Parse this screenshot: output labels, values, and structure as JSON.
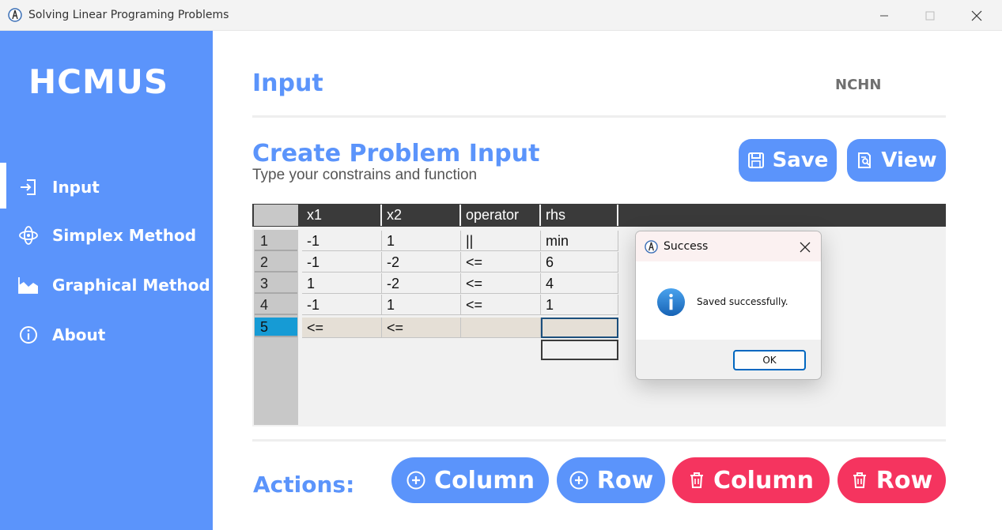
{
  "window": {
    "title": "Solving Linear Programing Problems",
    "minimize": "—",
    "maximize": "☐",
    "close": "✕"
  },
  "sidebar": {
    "brand": "HCMUS",
    "items": [
      {
        "label": "Input",
        "icon": "sign-in-icon",
        "active": true
      },
      {
        "label": "Simplex Method",
        "icon": "atom-icon"
      },
      {
        "label": "Graphical Method",
        "icon": "area-chart-icon"
      },
      {
        "label": "About",
        "icon": "info-circle-icon"
      }
    ]
  },
  "header": {
    "title": "Input",
    "user": "NCHN"
  },
  "section": {
    "title": "Create Problem Input",
    "subtitle": "Type your constrains and function",
    "save_label": "Save",
    "view_label": "View"
  },
  "grid": {
    "columns": [
      "x1",
      "x2",
      "operator",
      "rhs"
    ],
    "rows": [
      {
        "num": "1",
        "cells": [
          "-1",
          "1",
          "||",
          "min"
        ]
      },
      {
        "num": "2",
        "cells": [
          "-1",
          "-2",
          "<=",
          "6"
        ]
      },
      {
        "num": "3",
        "cells": [
          "1",
          "-2",
          "<=",
          "4"
        ]
      },
      {
        "num": "4",
        "cells": [
          "-1",
          "1",
          "<=",
          "1"
        ]
      },
      {
        "num": "5",
        "cells": [
          "<=",
          "<=",
          "",
          ""
        ],
        "new_row": true
      }
    ]
  },
  "actions": {
    "label": "Actions:",
    "add_column": "Column",
    "add_row": "Row",
    "delete_column": "Column",
    "delete_row": "Row"
  },
  "dialog": {
    "title": "Success",
    "message": "Saved successfully.",
    "ok": "OK",
    "close": "✕"
  },
  "colors": {
    "accent": "#5b94fb",
    "danger": "#f5345f",
    "selected_row": "#169bd5"
  }
}
